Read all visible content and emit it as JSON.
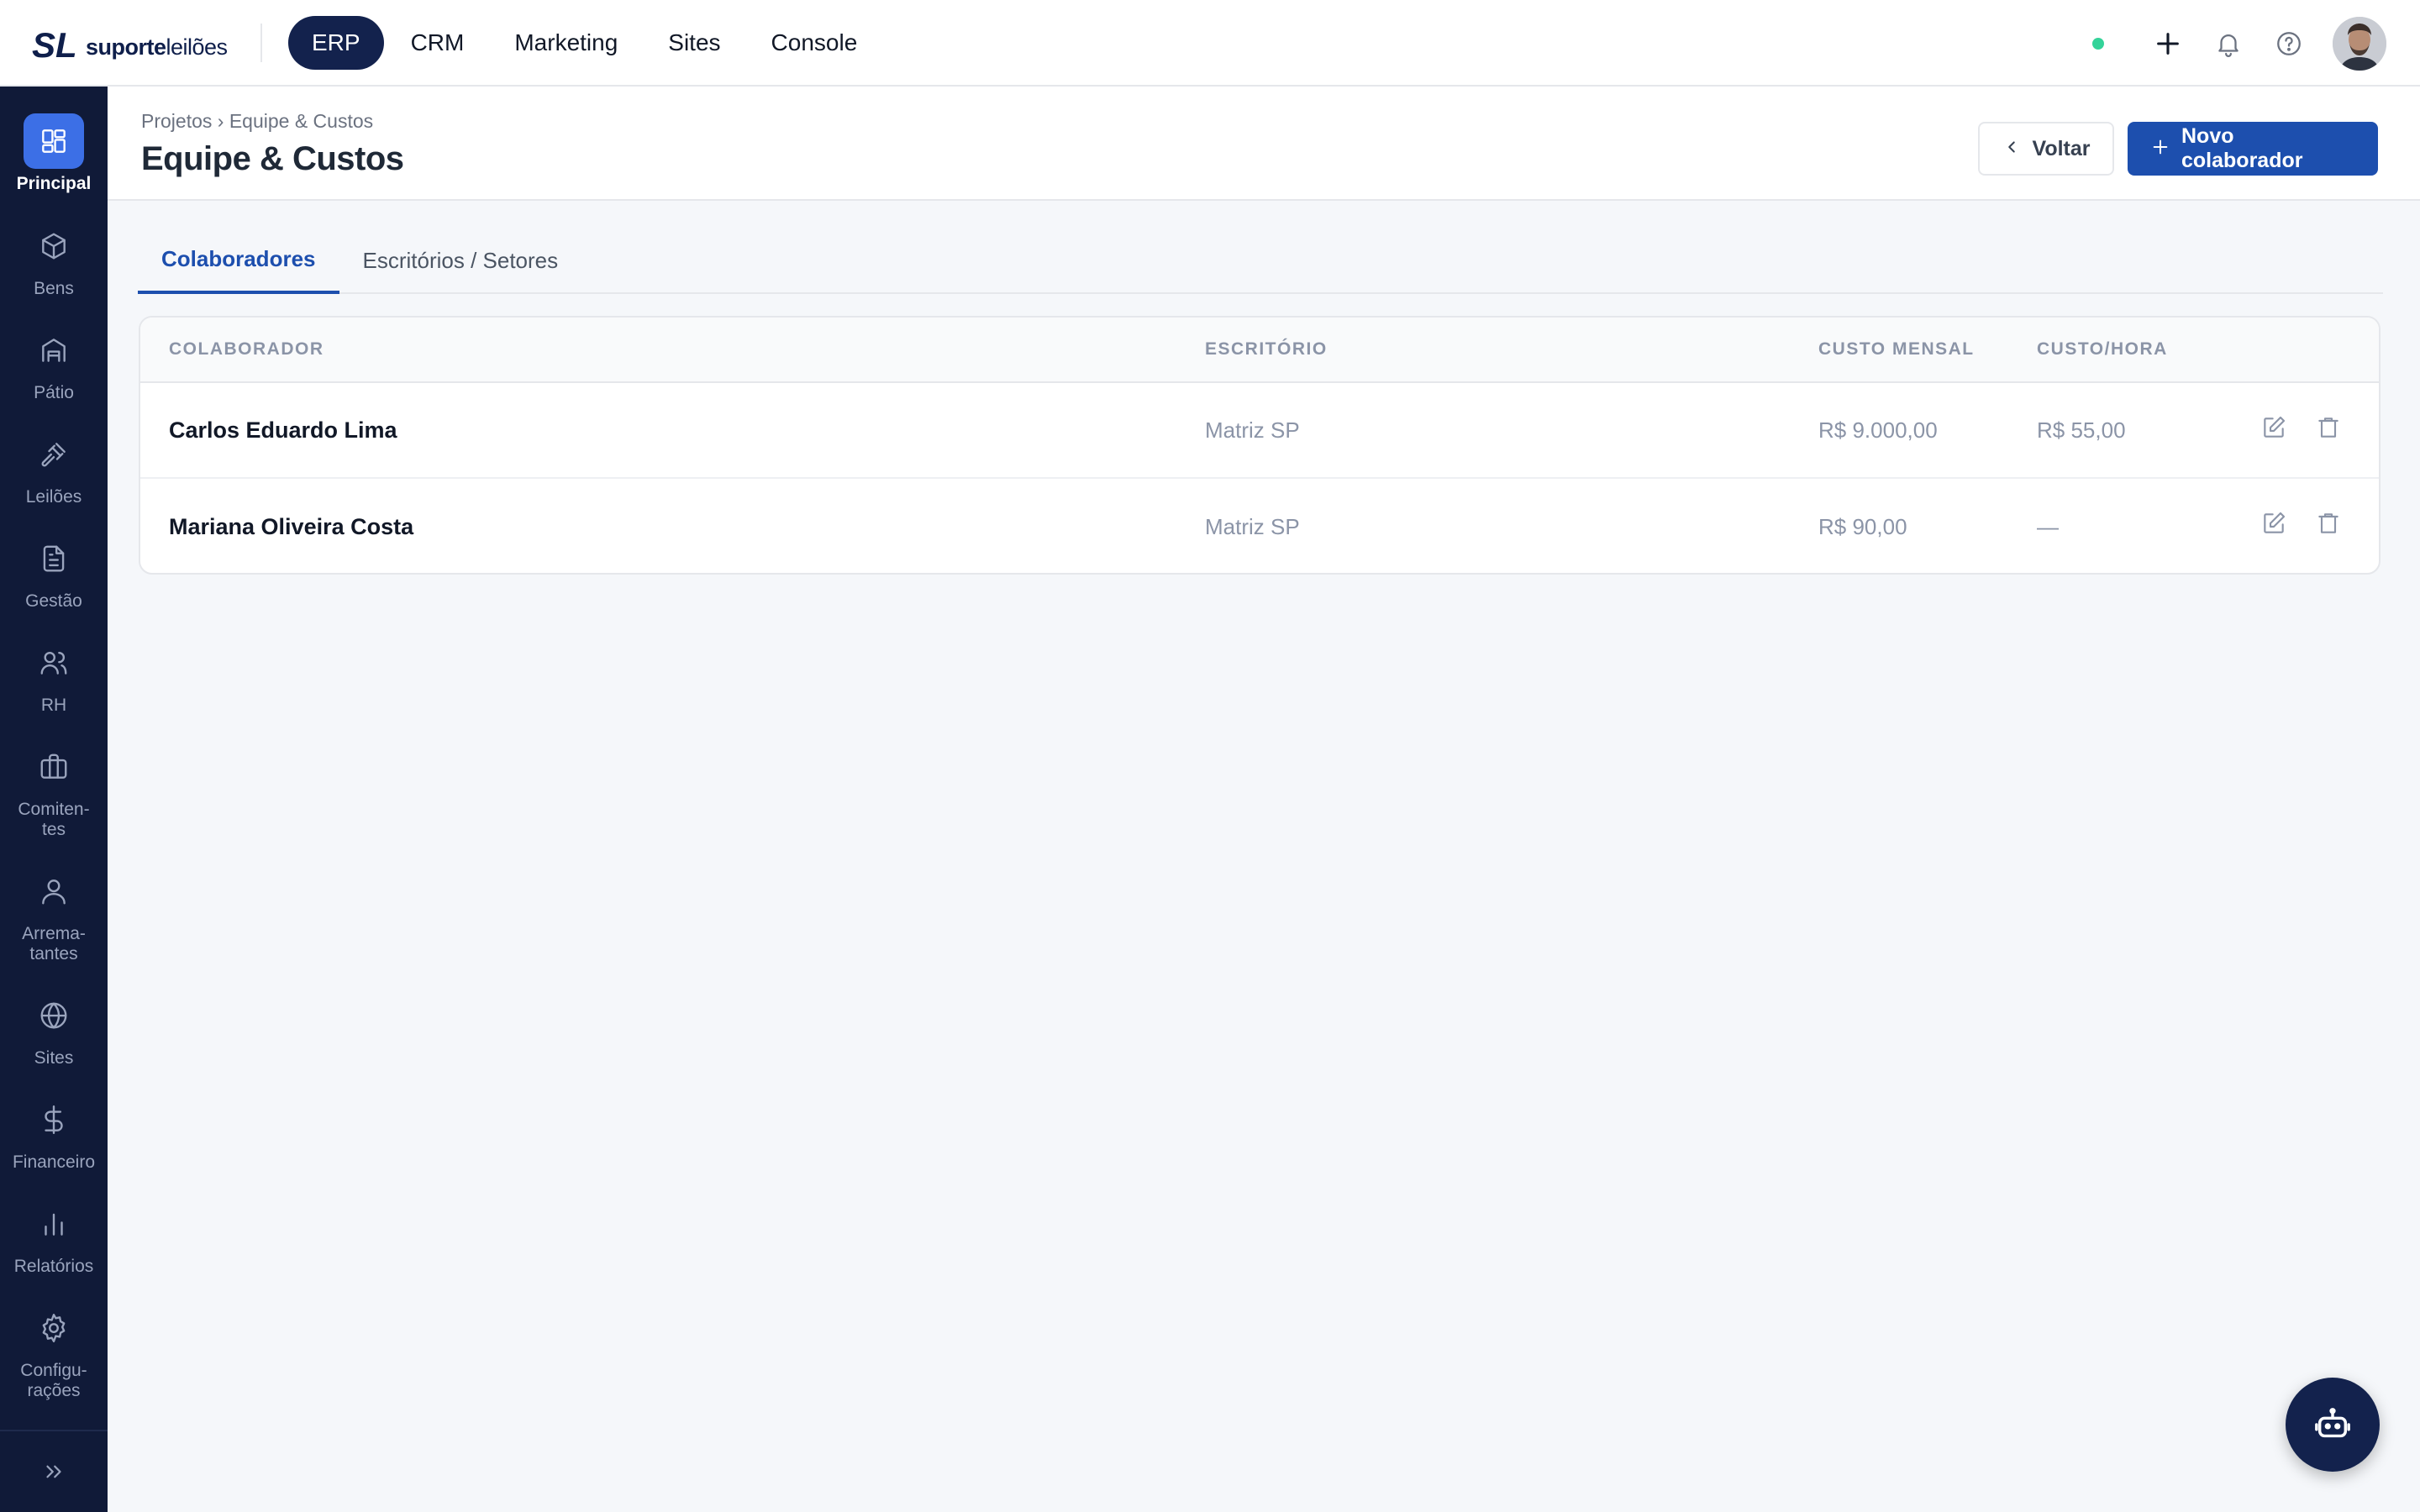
{
  "brand": {
    "name_bold": "suporte",
    "name_light": "leilões"
  },
  "topnav": [
    {
      "label": "ERP",
      "active": true
    },
    {
      "label": "CRM"
    },
    {
      "label": "Marketing"
    },
    {
      "label": "Sites"
    },
    {
      "label": "Console"
    }
  ],
  "sidebar": [
    {
      "label": "Principal",
      "icon": "dashboard-icon",
      "active": true
    },
    {
      "label": "Bens",
      "icon": "box-icon"
    },
    {
      "label": "Pátio",
      "icon": "warehouse-icon"
    },
    {
      "label": "Leilões",
      "icon": "gavel-icon"
    },
    {
      "label": "Gestão",
      "icon": "document-icon"
    },
    {
      "label": "RH",
      "icon": "users-icon"
    },
    {
      "label": "Comiten-\ntes",
      "icon": "briefcase-icon"
    },
    {
      "label": "Arrema-\ntantes",
      "icon": "user-icon"
    },
    {
      "label": "Sites",
      "icon": "globe-icon"
    },
    {
      "label": "Financeiro",
      "icon": "dollar-icon"
    },
    {
      "label": "Relatórios",
      "icon": "bar-chart-icon"
    },
    {
      "label": "Configu-\nrações",
      "icon": "gear-icon"
    }
  ],
  "header": {
    "breadcrumb": "Projetos › Equipe & Custos",
    "title": "Equipe & Custos",
    "back_label": "Voltar",
    "new_label": "Novo colaborador"
  },
  "tabs": [
    {
      "label": "Colaboradores",
      "active": true
    },
    {
      "label": "Escritórios / Setores"
    }
  ],
  "table": {
    "columns": [
      "COLABORADOR",
      "ESCRITÓRIO",
      "CUSTO MENSAL",
      "CUSTO/HORA"
    ],
    "rows": [
      {
        "name": "Carlos Eduardo Lima",
        "office": "Matriz SP",
        "monthly": "R$ 9.000,00",
        "hourly": "R$ 55,00"
      },
      {
        "name": "Mariana Oliveira Costa",
        "office": "Matriz SP",
        "monthly": "R$ 90,00",
        "hourly": "—"
      }
    ]
  },
  "colors": {
    "navy": "#13224d",
    "primary": "#1d4fae",
    "sidebar": "#101a38",
    "active_side": "#3c6fe6",
    "status": "#34d399"
  }
}
